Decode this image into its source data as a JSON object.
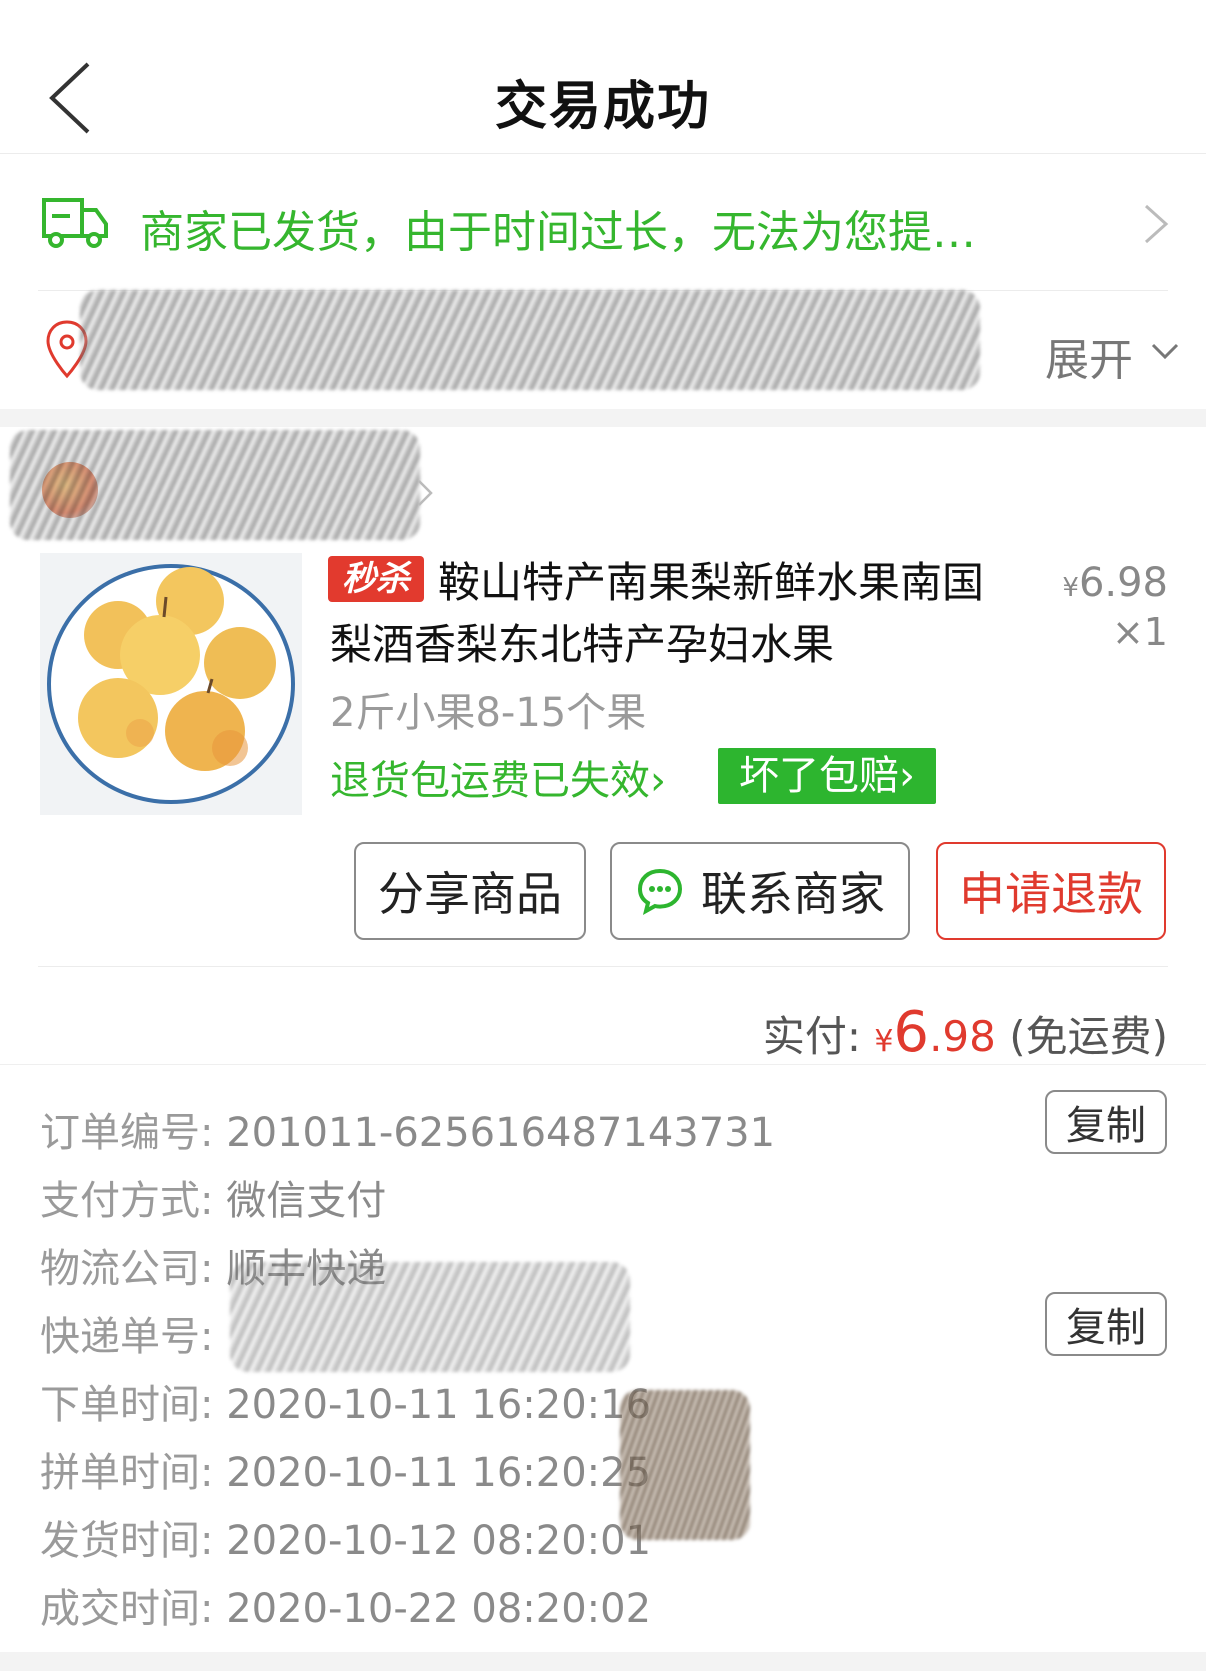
{
  "header": {
    "title": "交易成功"
  },
  "logistics": {
    "status_text": "商家已发货，由于时间过长，无法为您提…"
  },
  "address": {
    "expand_label": "展开"
  },
  "product": {
    "badge": "秒杀",
    "name": "鞍山特产南果梨新鲜水果南国梨酒香梨东北特产孕妇水果",
    "price_currency": "¥",
    "price": "6.98",
    "quantity": "×1",
    "spec": "2斤小果8-15个果",
    "return_shipping": "退货包运费已失效",
    "return_arrow": "›",
    "bad_guarantee": "坏了包赔›"
  },
  "actions": {
    "share_label": "分享商品",
    "contact_label": "联系商家",
    "refund_label": "申请退款"
  },
  "total": {
    "label": "实付:",
    "currency": "¥",
    "amount_int": "6",
    "amount_dec": ".98",
    "note": "(免运费)"
  },
  "order": {
    "copy_label": "复制",
    "rows": [
      {
        "label": "订单编号:",
        "value": "201011-625616487143731"
      },
      {
        "label": "支付方式:",
        "value": "微信支付"
      },
      {
        "label": "物流公司:",
        "value": "顺丰快递"
      },
      {
        "label": "快递单号:",
        "value": ""
      },
      {
        "label": "下单时间:",
        "value": "2020-10-11 16:20:16"
      },
      {
        "label": "拼单时间:",
        "value": "2020-10-11 16:20:25"
      },
      {
        "label": "发货时间:",
        "value": "2020-10-12 08:20:01"
      },
      {
        "label": "成交时间:",
        "value": "2020-10-22 08:20:02"
      }
    ]
  },
  "icons": {
    "back": "chevron-left-icon",
    "truck": "truck-icon",
    "pin": "location-pin-icon",
    "chat": "chat-bubble-icon"
  },
  "colors": {
    "green": "#35b62e",
    "red": "#e03a2e",
    "badge_red": "#e23a2e",
    "tag_green": "#2db52f"
  }
}
